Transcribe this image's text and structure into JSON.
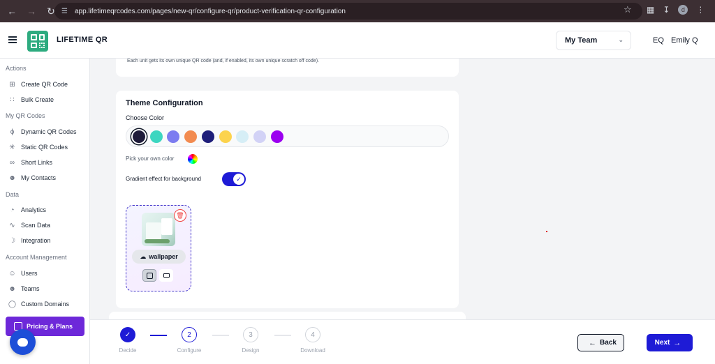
{
  "browser": {
    "url": "app.lifetimeqrcodes.com/pages/new-qr/configure-qr/product-verification-qr-configuration",
    "profile_initial": "d"
  },
  "header": {
    "brand": "LIFETIME QR",
    "team_select": "My Team",
    "user_initials": "EQ",
    "user_name": "Emily Q"
  },
  "sidebar": {
    "sections": {
      "actions": "Actions",
      "my_qr_codes": "My QR Codes",
      "data": "Data",
      "account_management": "Account Management"
    },
    "items": {
      "create_qr": "Create QR Code",
      "bulk_create": "Bulk Create",
      "dynamic_qr": "Dynamic QR Codes",
      "static_qr": "Static QR Codes",
      "short_links": "Short Links",
      "my_contacts": "My Contacts",
      "analytics": "Analytics",
      "scan_data": "Scan Data",
      "integration": "Integration",
      "users": "Users",
      "teams": "Teams",
      "custom_domains": "Custom Domains"
    },
    "pricing": "Pricing & Plans"
  },
  "main": {
    "top_card_desc": "Each unit gets its own unique QR code (and, if enabled, its own unique scratch  off code).",
    "theme": {
      "title": "Theme Configuration",
      "choose_color": "Choose Color",
      "swatches": [
        "#1f1b3a",
        "#3dd6c0",
        "#7c7cf0",
        "#f28b50",
        "#1e1e7a",
        "#fcd34d",
        "#d6eef6",
        "#d2d2f6",
        "#9b00f0"
      ],
      "pick_own": "Pick your own color",
      "gradient_label": "Gradient effect for background",
      "gradient_enabled": true,
      "wallpaper_label": "wallpaper"
    }
  },
  "stepper": {
    "steps": [
      {
        "num": "",
        "label": "Decide",
        "state": "done"
      },
      {
        "num": "2",
        "label": "Configure",
        "state": "current"
      },
      {
        "num": "3",
        "label": "Design",
        "state": "future"
      },
      {
        "num": "4",
        "label": "Download",
        "state": "future"
      }
    ],
    "back": "Back",
    "next": "Next"
  },
  "colors": {
    "accent": "#1e1bd6",
    "brand_green": "#2dab7f",
    "pricing_purple": "#6d28d9"
  }
}
